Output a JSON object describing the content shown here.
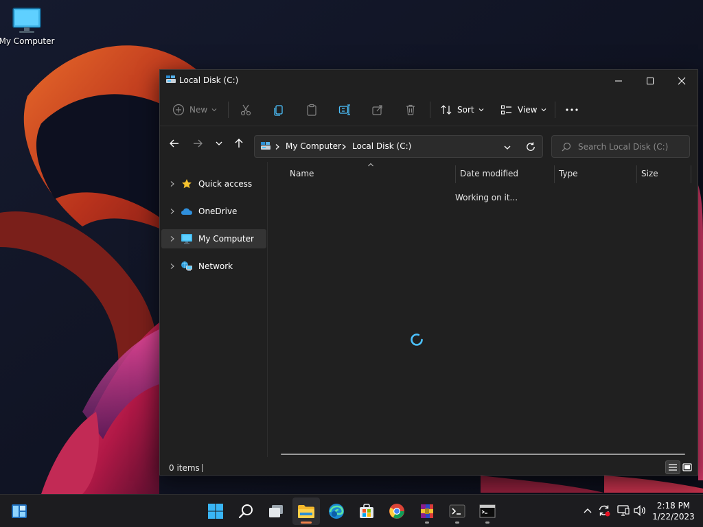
{
  "desktop": {
    "icons": [
      {
        "label": "My Computer",
        "icon": "monitor-icon"
      }
    ]
  },
  "window": {
    "title": "Local Disk (C:)",
    "toolbar": {
      "new_label": "New",
      "sort_label": "Sort",
      "view_label": "View",
      "icons": [
        "new-icon",
        "cut-icon",
        "copy-icon",
        "paste-icon",
        "rename-icon",
        "share-icon",
        "delete-icon",
        "sort-icon",
        "view-icon",
        "more-icon"
      ]
    },
    "address": {
      "breadcrumbs": [
        "My Computer",
        "Local Disk (C:)"
      ]
    },
    "search": {
      "placeholder": "Search Local Disk (C:)"
    },
    "sidebar": {
      "items": [
        {
          "label": "Quick access",
          "icon": "star-icon",
          "selected": false
        },
        {
          "label": "OneDrive",
          "icon": "cloud-icon",
          "selected": false
        },
        {
          "label": "My Computer",
          "icon": "monitor-icon",
          "selected": true
        },
        {
          "label": "Network",
          "icon": "network-icon",
          "selected": false
        }
      ]
    },
    "columns": [
      "Name",
      "Date modified",
      "Type",
      "Size"
    ],
    "status_message": "Working on it...",
    "status_bar": {
      "items_count": "0 items"
    }
  },
  "taskbar": {
    "apps": [
      {
        "name": "Start",
        "icon": "windows-logo-icon"
      },
      {
        "name": "Search",
        "icon": "search-icon"
      },
      {
        "name": "Task View",
        "icon": "task-view-icon"
      },
      {
        "name": "File Explorer",
        "icon": "folder-icon",
        "active": true
      },
      {
        "name": "Microsoft Edge",
        "icon": "edge-icon"
      },
      {
        "name": "Microsoft Store",
        "icon": "store-icon"
      },
      {
        "name": "Google Chrome",
        "icon": "chrome-icon"
      },
      {
        "name": "WinRAR",
        "icon": "winrar-icon"
      },
      {
        "name": "Terminal",
        "icon": "terminal-icon"
      },
      {
        "name": "Command Prompt",
        "icon": "cmd-icon"
      }
    ],
    "tray_icons": [
      "chevron-up-icon",
      "sync-icon",
      "network-icon",
      "volume-icon"
    ],
    "clock": {
      "time": "2:18 PM",
      "date": "1/22/2023"
    }
  },
  "colors": {
    "window_bg": "#202020",
    "accent": "#4cc2ff",
    "taskbar_bg": "#1c1c1f",
    "active_indicator": "#f0824a"
  }
}
